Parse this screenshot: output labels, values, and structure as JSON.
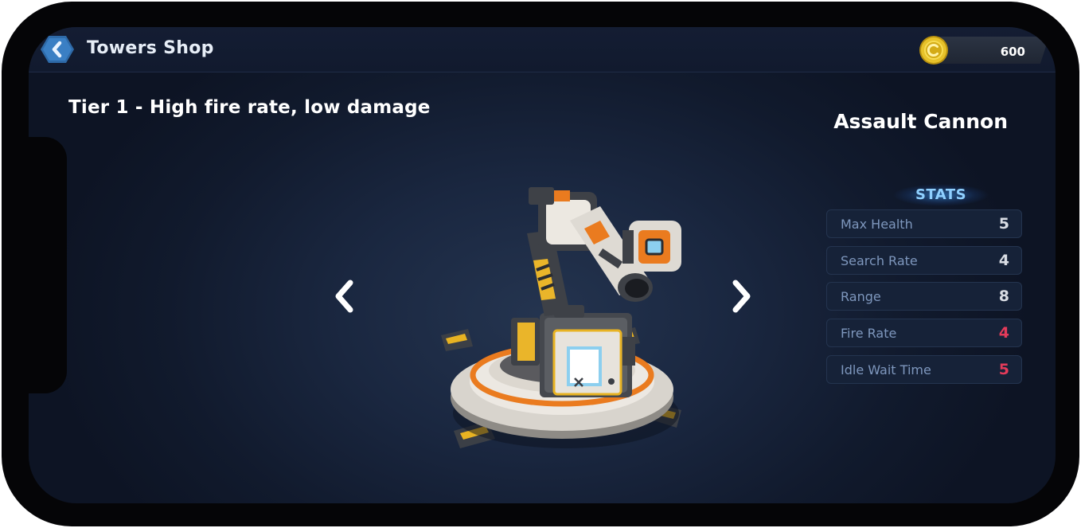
{
  "header": {
    "title": "Towers Shop",
    "coins": "600"
  },
  "tier_text": "Tier 1 - High fire rate, low damage",
  "tower": {
    "name": "Assault Cannon"
  },
  "stats": {
    "heading": "STATS",
    "items": [
      {
        "label": "Max Health",
        "value": "5",
        "color": "#d9dde4"
      },
      {
        "label": "Search Rate",
        "value": "4",
        "color": "#d9dde4"
      },
      {
        "label": "Range",
        "value": "8",
        "color": "#d9dde4"
      },
      {
        "label": "Fire Rate",
        "value": "4",
        "color": "#e43b5a"
      },
      {
        "label": "Idle Wait Time",
        "value": "5",
        "color": "#e43b5a"
      }
    ]
  },
  "icons": {
    "back": "chevron-left-icon",
    "coin": "coin-icon",
    "prev": "arrow-left-icon",
    "next": "arrow-right-icon"
  },
  "colors": {
    "accent": "#8fd0ff",
    "highlight": "#e43b5a",
    "coin": "#e7c22a"
  }
}
